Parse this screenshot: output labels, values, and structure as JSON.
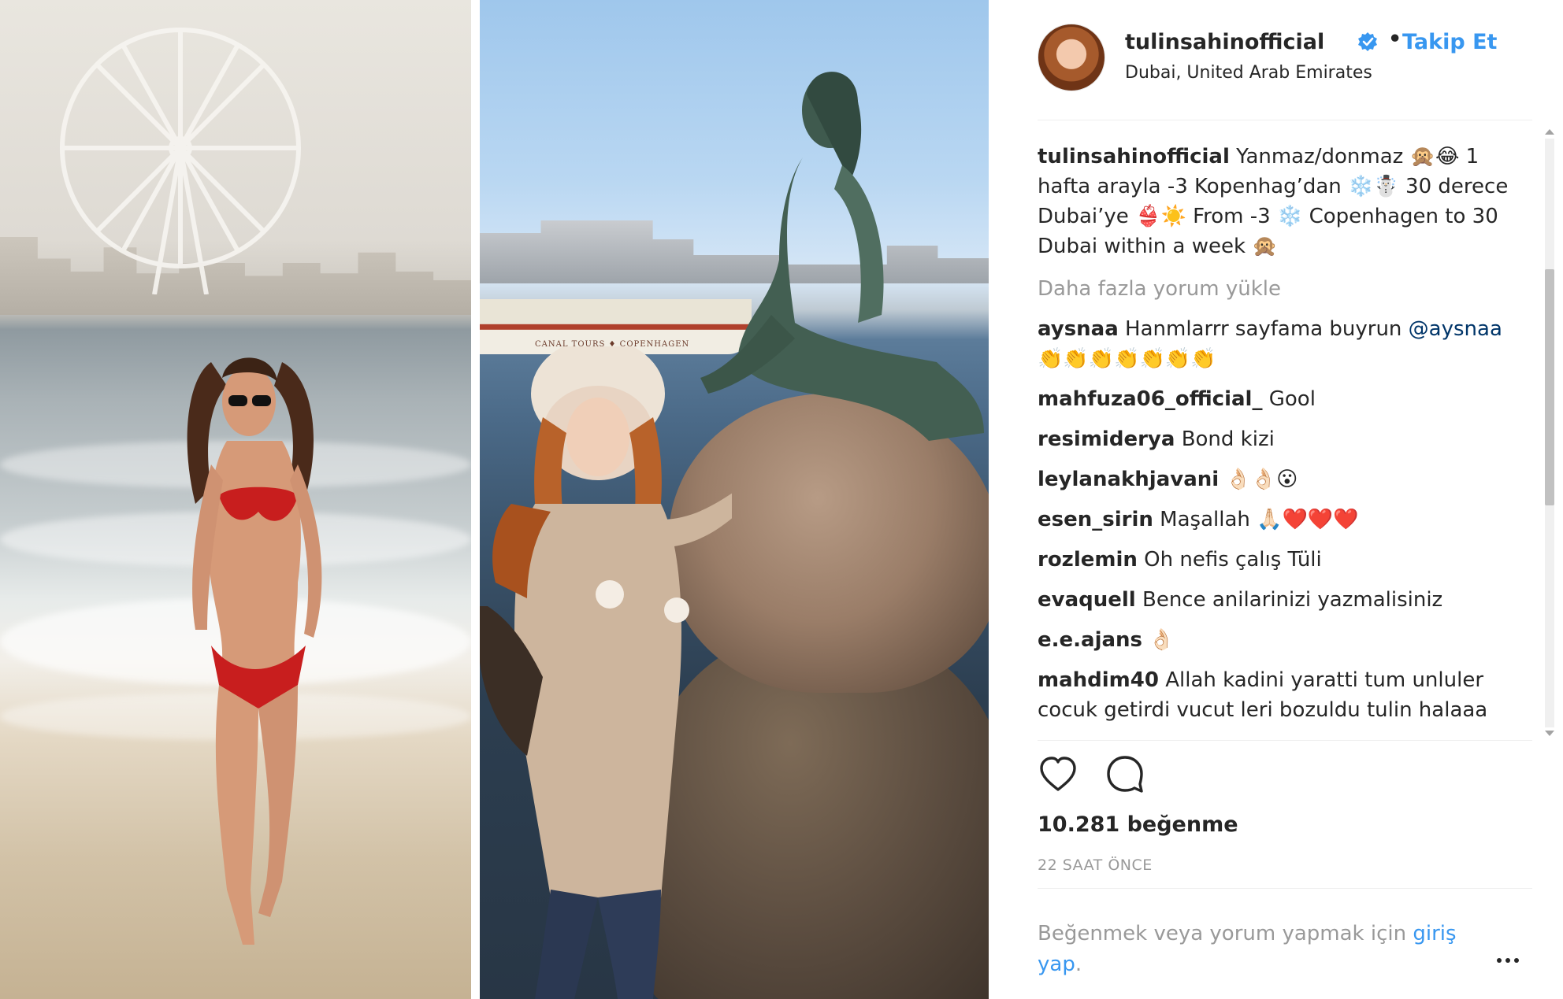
{
  "post": {
    "username": "tulinsahinofficial",
    "separator": "•",
    "follow_label": "Takip Et",
    "location": "Dubai, United Arab Emirates"
  },
  "caption": {
    "username": "tulinsahinofficial",
    "text": "Yanmaz/donmaz 🙊😂 1 hafta arayla -3 Kopenhag’dan ❄️☃️ 30 derece Dubai’ye 👙☀️ From -3 ❄️ Copenhagen to 30 Dubai within a week 🙊"
  },
  "load_more_label": "Daha fazla yorum yükle",
  "comments": [
    {
      "user": "aysnaa",
      "text": "Hanmlarrr sayfama buyrun ",
      "mention": "@aysnaa",
      "extra": "👏👏👏👏👏👏👏"
    },
    {
      "user": "mahfuza06_official_",
      "text": "Gool"
    },
    {
      "user": "resimiderya",
      "text": "Bond kizi"
    },
    {
      "user": "leylanakhjavani",
      "text": "👌🏻👌🏻😮"
    },
    {
      "user": "esen_sirin",
      "text": "Maşallah 🙏🏻❤️❤️❤️"
    },
    {
      "user": "rozlemin",
      "text": "Oh nefis çalış Tüli"
    },
    {
      "user": "evaquell",
      "text": "Bence anilarinizi yazmalisiniz"
    },
    {
      "user": "e.e.ajans",
      "text": "👌🏻"
    },
    {
      "user": "mahdim40",
      "text": "Allah kadini yaratti tum unluler cocuk getirdi vucut leri bozuldu tulin halaaa"
    }
  ],
  "likes_label": "10.281 beğenme",
  "time_label": "22 SAAT ÖNCE",
  "login": {
    "prefix": "Beğenmek veya yorum yapmak için ",
    "link": "giriş yap",
    "suffix": "."
  },
  "photo_right": {
    "boat_sign": "CANAL TOURS ♦ COPENHAGEN"
  },
  "colors": {
    "link_blue": "#3897f0",
    "mention_blue": "#003569",
    "muted": "#999999",
    "text": "#262626"
  },
  "icons": [
    "verified-badge-icon",
    "heart-icon",
    "comment-bubble-icon",
    "more-options-icon"
  ]
}
